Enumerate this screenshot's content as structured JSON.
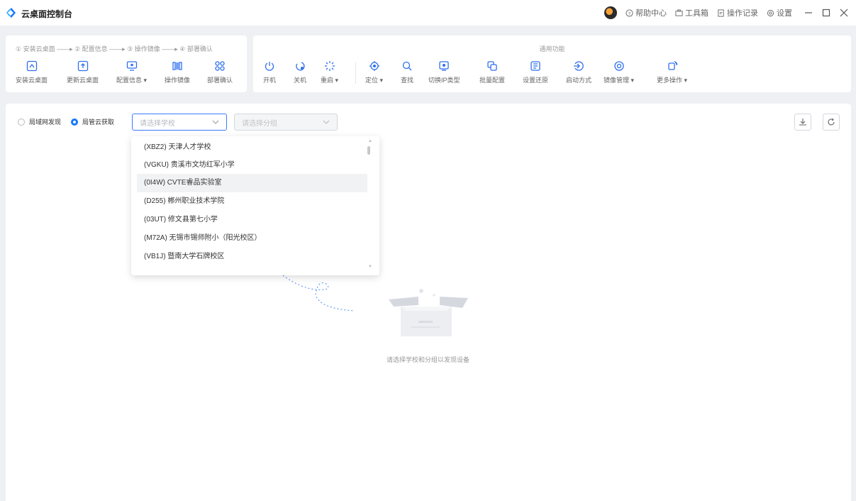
{
  "app": {
    "title": "云桌面控制台"
  },
  "titlebar": {
    "help": "帮助中心",
    "toolbox": "工具箱",
    "oplog": "操作记录",
    "settings": "设置"
  },
  "steps_text": "① 安装云桌面 ——▸ ② 配置信息 ——▸ ③ 操作镜像 ——▸ ④ 部署确认",
  "left_tools": [
    "安装云桌面",
    "更新云桌面",
    "配置信息 ▾",
    "操作镜像",
    "部署确认"
  ],
  "group_title": "通用功能",
  "right_tools": [
    "开机",
    "关机",
    "重启 ▾",
    "定位 ▾",
    "查找",
    "切换IP类型",
    "批量配置",
    "设置还原",
    "启动方式",
    "镜像管理 ▾",
    "更多操作 ▾"
  ],
  "discovery": {
    "lan": "局域网发现",
    "cloud": "局管云获取"
  },
  "school_select": {
    "placeholder": "请选择学校"
  },
  "group_select": {
    "placeholder": "请选择分组"
  },
  "schools": [
    "(XBZ2) 天津人才学校",
    "(VGKU) 贵溪市文坊红军小学",
    "(0I4W) CVTE睿品实验室",
    "(D255) 郴州职业技术学院",
    "(03UT) 修文县第七小学",
    "(M72A) 无锡市锡师附小（阳光校区）",
    "(VB1J) 暨南大学石牌校区"
  ],
  "highlighted_index": 2,
  "empty_hint": "请选择学校和分组以发现设备",
  "colors": {
    "accent": "#1677ff",
    "background": "#eef0f4"
  }
}
